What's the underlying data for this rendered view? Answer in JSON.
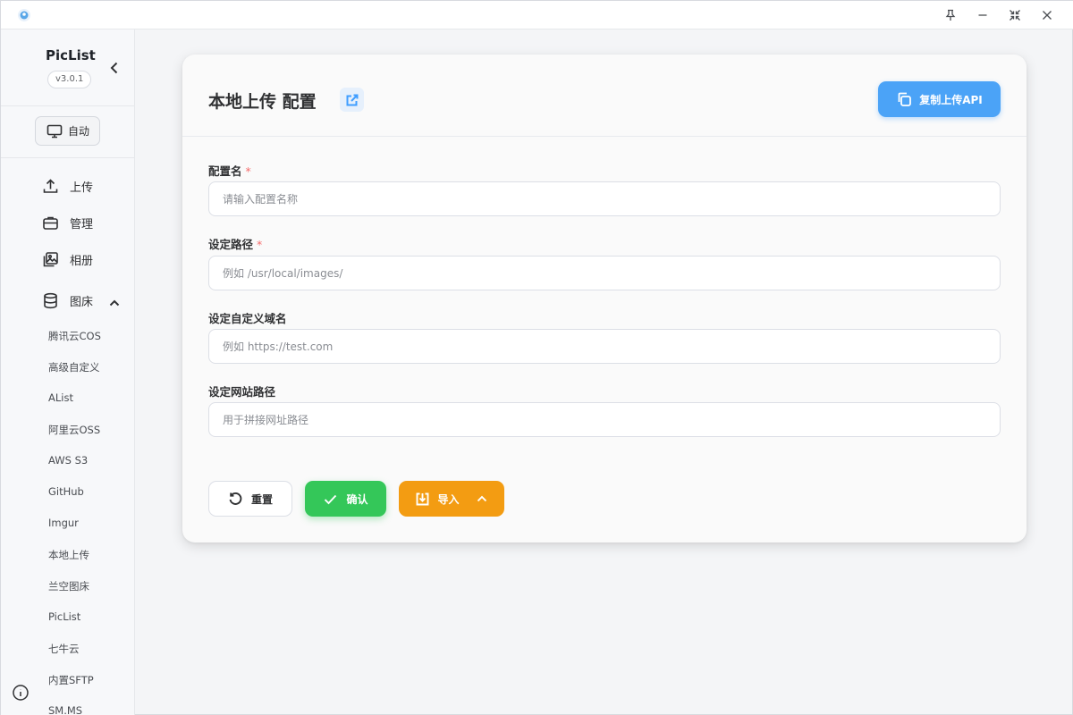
{
  "app": {
    "name": "PicList",
    "version": "v3.0.1"
  },
  "sidebar": {
    "theme_label": "自动",
    "nav": [
      {
        "label": "上传"
      },
      {
        "label": "管理"
      },
      {
        "label": "相册"
      },
      {
        "label": "图床"
      }
    ],
    "hosts": [
      "腾讯云COS",
      "高级自定义",
      "AList",
      "阿里云OSS",
      "AWS S3",
      "GitHub",
      "Imgur",
      "本地上传",
      "兰空图床",
      "PicList",
      "七牛云",
      "内置SFTP",
      "SM.MS"
    ]
  },
  "page": {
    "title": "本地上传 配置",
    "copy_api_label": "复制上传API"
  },
  "form": {
    "fields": [
      {
        "label": "配置名",
        "required": "*",
        "placeholder": "请输入配置名称",
        "value": ""
      },
      {
        "label": "设定路径",
        "required": "*",
        "placeholder": "例如 /usr/local/images/",
        "value": ""
      },
      {
        "label": "设定自定义域名",
        "placeholder": "例如 https://test.com",
        "value": ""
      },
      {
        "label": "设定网站路径",
        "placeholder": "用于拼接网址路径",
        "value": ""
      }
    ],
    "buttons": {
      "reset": "重置",
      "confirm": "确认",
      "import": "导入"
    }
  },
  "colors": {
    "primary": "#4ba3f7",
    "success": "#34c759",
    "warning": "#f39c12",
    "required": "#f56c6c"
  }
}
